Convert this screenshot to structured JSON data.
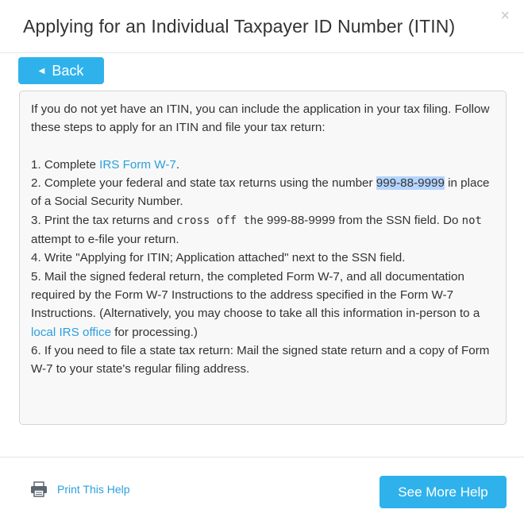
{
  "dialog": {
    "title": "Applying for an Individual Taxpayer ID Number (ITIN)",
    "close_glyph": "×"
  },
  "back_button": {
    "label": "Back",
    "icon": "caret-left-icon"
  },
  "content": {
    "intro": "If you do not yet have an ITIN, you can include the application in your tax filing. Follow these steps to apply for an ITIN and file your tax return:",
    "step1": {
      "prefix": "1. Complete ",
      "link": "IRS Form W-7",
      "suffix": "."
    },
    "step2": {
      "prefix": "2. Complete your federal and state tax returns using the number ",
      "highlight": "999-88-9999",
      "suffix": " in place of a Social Security Number."
    },
    "step3": {
      "prefix": "3. Print the tax returns and ",
      "mono1": "cross off the",
      "middle": " 999-88-9999 from the SSN field. Do ",
      "mono2": "not",
      "suffix": " attempt to e-file your return."
    },
    "step4": "4. Write \"Applying for ITIN; Application attached\" next to the SSN field.",
    "step5": {
      "prefix": "5. Mail the signed federal return, the completed Form W-7, and all documentation required by the Form W-7 Instructions to the address specified in the Form W-7 Instructions. (Alternatively, you may choose to take all this information in-person to a ",
      "link": "local IRS office",
      "suffix": " for processing.)"
    },
    "step6": "6. If you need to file a state tax return: Mail the signed state return and a copy of Form W-7 to your state's regular filing address."
  },
  "footer": {
    "print_label": "Print This Help",
    "print_icon": "printer-icon",
    "more_help_label": "See More Help"
  },
  "colors": {
    "accent": "#2fb2ec",
    "link": "#2b9fdd",
    "highlight": "#b5d5ff",
    "box_bg": "#f8f8f8"
  }
}
